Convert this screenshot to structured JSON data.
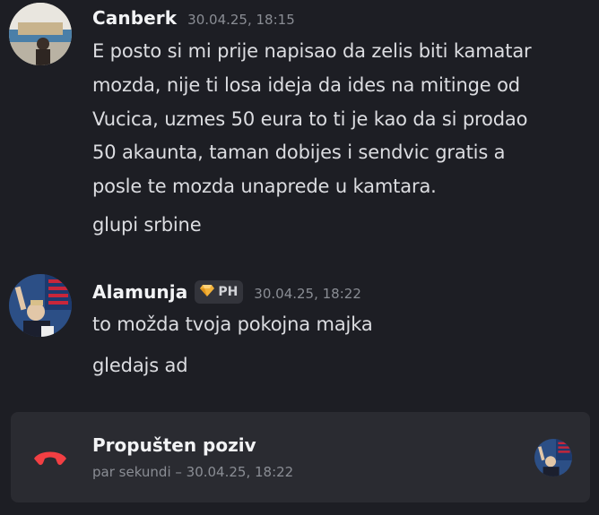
{
  "messages": [
    {
      "author": "Canberk",
      "timestamp": "30.04.25, 18:15",
      "lines": [
        "E posto si mi prije napisao da zelis biti kamatar",
        "mozda, nije ti losa ideja da ides na mitinge od",
        "Vucica, uzmes 50 eura to ti je kao da si prodao",
        "50 akaunta, taman dobijes i sendvic gratis a",
        "posle te mozda unaprede u kamtara.",
        "glupi srbine"
      ]
    },
    {
      "author": "Alamunja",
      "badge": {
        "icon": "diamond-icon",
        "label": "PH"
      },
      "timestamp": "30.04.25, 18:22",
      "lines": [
        "to možda tvoja pokojna majka",
        "gledajs ad"
      ]
    }
  ],
  "missed_call": {
    "title": "Propušten poziv",
    "subtitle": "par sekundi – 30.04.25, 18:22",
    "icon": "phone-hangup-icon",
    "icon_color": "#f23f43"
  },
  "colors": {
    "background": "#1d1e24",
    "call_card": "#2a2b31",
    "muted_text": "#8a8d94"
  }
}
